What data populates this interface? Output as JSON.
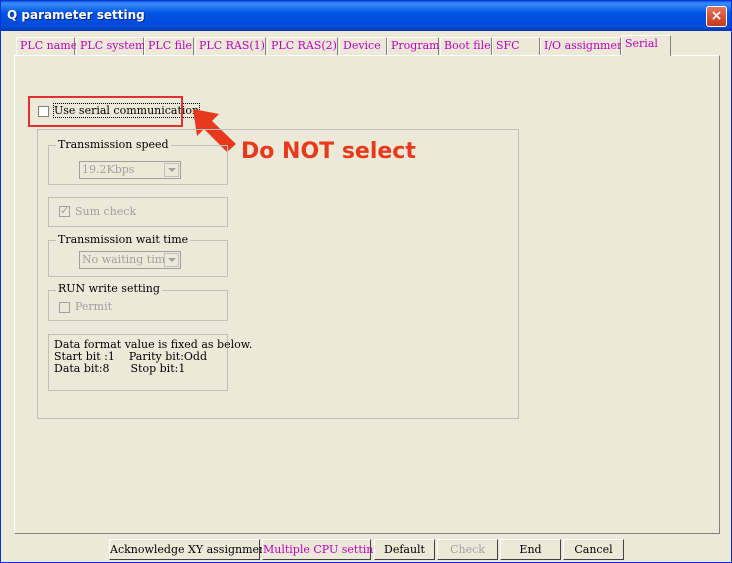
{
  "window": {
    "title": "Q parameter setting",
    "close_glyph": "×"
  },
  "tabs": [
    {
      "label": "PLC name"
    },
    {
      "label": "PLC system"
    },
    {
      "label": "PLC file"
    },
    {
      "label": "PLC RAS(1)"
    },
    {
      "label": "PLC RAS(2)"
    },
    {
      "label": "Device"
    },
    {
      "label": "Program"
    },
    {
      "label": "Boot file"
    },
    {
      "label": "SFC"
    },
    {
      "label": "I/O assignment"
    },
    {
      "label": "Serial",
      "active": true
    }
  ],
  "serial": {
    "use_serial_label": "Use serial communication",
    "use_serial_checked": false,
    "transmission_speed": {
      "title": "Transmission speed",
      "value": "19.2Kbps"
    },
    "sum_check": {
      "label": "Sum check",
      "checked": true
    },
    "wait_time": {
      "title": "Transmission wait time",
      "value": "No waiting time"
    },
    "run_write": {
      "title": "RUN write setting",
      "permit_label": "Permit",
      "checked": false
    },
    "data_format": {
      "line1": "Data format value is fixed as below.",
      "line2": "Start bit :1    Parity bit:Odd",
      "line3": "Data bit:8      Stop bit:1"
    }
  },
  "annotation": {
    "text": "Do NOT select",
    "color": "#e8391c"
  },
  "buttons": {
    "acknowledge": "Acknowledge XY assignment",
    "multiple_cpu": "Multiple CPU settings",
    "default": "Default",
    "check": "Check",
    "end": "End",
    "cancel": "Cancel"
  },
  "colors": {
    "tab_text": "#c000c0",
    "title_bar": "#0055e5",
    "face": "#ece9d8"
  }
}
